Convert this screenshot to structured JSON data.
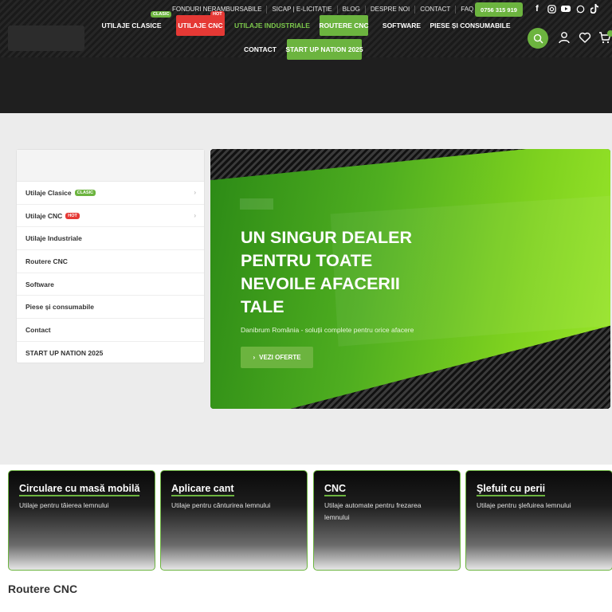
{
  "topbar": {
    "links": [
      "FONDURI NERAMBURSABILE",
      "SICAP | E-LICITAȚIE",
      "BLOG",
      "DESPRE NOI",
      "CONTACT",
      "FAQ"
    ],
    "phone": "0756 315 919"
  },
  "nav": {
    "items": [
      "UTILAJE CLASICE",
      "UTILAJE CNC",
      "UTILAJE INDUSTRIALE",
      "ROUTERE CNC",
      "SOFTWARE",
      "PIESE ȘI CONSUMABILE",
      "CONTACT",
      "START UP NATION 2025"
    ],
    "badge_clasic": "CLASIC",
    "badge_hot": "HOT"
  },
  "sidebar": {
    "items": [
      "Utilaje Clasice",
      "Utilaje CNC",
      "Utilaje Industriale",
      "Routere CNC",
      "Software",
      "Piese și consumabile",
      "Contact",
      "START UP NATION 2025"
    ],
    "badge_clasic": "CLASIC",
    "badge_hot": "HOT"
  },
  "hero": {
    "title": "UN SINGUR DEALER PENTRU TOATE NEVOILE AFACERII TALE",
    "subtitle": "Danibrum România - soluții complete pentru orice afacere",
    "cta": "VEZI OFERTE"
  },
  "cards": [
    {
      "title": "Circulare cu masă mobilă",
      "desc": "Utilaje pentru tăierea lemnului"
    },
    {
      "title": "Aplicare cant",
      "desc": "Utilaje pentru cănturirea lemnului"
    },
    {
      "title": "CNC",
      "desc": "Utilaje automate pentru frezarea lemnului"
    },
    {
      "title": "Şlefuit cu perii",
      "desc": "Utilaje pentru şlefuirea lemnului"
    }
  ],
  "section_title": "Routere CNC",
  "colors": {
    "accent": "#6cb43f",
    "hot": "#e53935",
    "header": "#1f1f1f"
  }
}
